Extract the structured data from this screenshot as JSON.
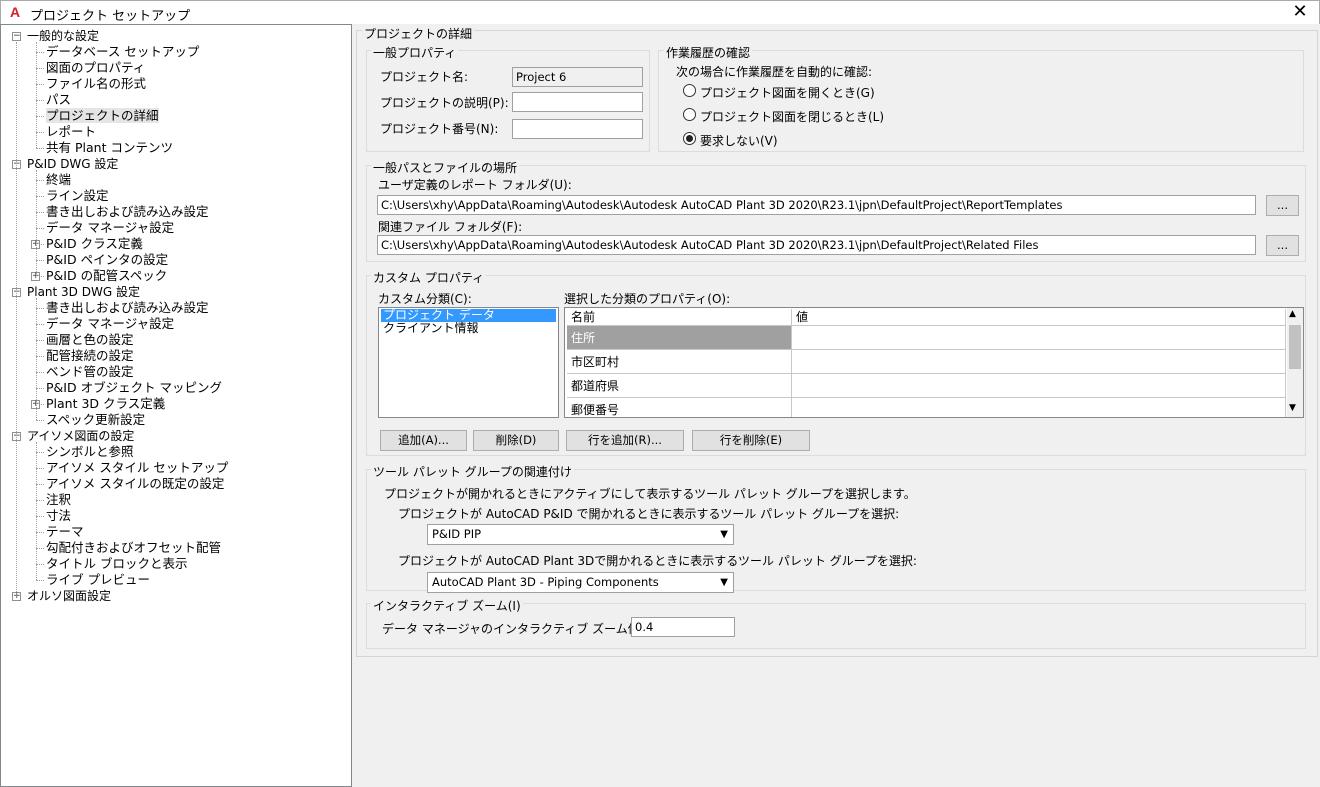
{
  "window": {
    "title": "プロジェクト セットアップ",
    "app_icon": "A"
  },
  "tree": [
    {
      "label": "一般的な設定",
      "level": 0,
      "expander": "−"
    },
    {
      "label": "データベース セットアップ",
      "level": 1
    },
    {
      "label": "図面のプロパティ",
      "level": 1
    },
    {
      "label": "ファイル名の形式",
      "level": 1
    },
    {
      "label": "パス",
      "level": 1
    },
    {
      "label": "プロジェクトの詳細",
      "level": 1,
      "selected": true
    },
    {
      "label": "レポート",
      "level": 1
    },
    {
      "label": "共有 Plant コンテンツ",
      "level": 1
    },
    {
      "label": "P&ID DWG 設定",
      "level": 0,
      "expander": "−"
    },
    {
      "label": "終端",
      "level": 1
    },
    {
      "label": "ライン設定",
      "level": 1
    },
    {
      "label": "書き出しおよび読み込み設定",
      "level": 1
    },
    {
      "label": "データ マネージャ設定",
      "level": 1
    },
    {
      "label": "P&ID クラス定義",
      "level": 1,
      "expander": "+"
    },
    {
      "label": "P&ID ペインタの設定",
      "level": 1
    },
    {
      "label": "P&ID の配管スペック",
      "level": 1,
      "expander": "+"
    },
    {
      "label": "Plant 3D DWG 設定",
      "level": 0,
      "expander": "−"
    },
    {
      "label": "書き出しおよび読み込み設定",
      "level": 1
    },
    {
      "label": "データ マネージャ設定",
      "level": 1
    },
    {
      "label": "画層と色の設定",
      "level": 1
    },
    {
      "label": "配管接続の設定",
      "level": 1
    },
    {
      "label": "ベンド管の設定",
      "level": 1
    },
    {
      "label": "P&ID オブジェクト マッピング",
      "level": 1
    },
    {
      "label": "Plant 3D クラス定義",
      "level": 1,
      "expander": "+"
    },
    {
      "label": "スペック更新設定",
      "level": 1
    },
    {
      "label": "アイソメ図面の設定",
      "level": 0,
      "expander": "−"
    },
    {
      "label": "シンボルと参照",
      "level": 1
    },
    {
      "label": "アイソメ スタイル セットアップ",
      "level": 1
    },
    {
      "label": "アイソメ スタイルの既定の設定",
      "level": 1
    },
    {
      "label": "注釈",
      "level": 1
    },
    {
      "label": "寸法",
      "level": 1
    },
    {
      "label": "テーマ",
      "level": 1
    },
    {
      "label": "勾配付きおよびオフセット配管",
      "level": 1
    },
    {
      "label": "タイトル ブロックと表示",
      "level": 1
    },
    {
      "label": "ライブ プレビュー",
      "level": 1
    },
    {
      "label": "オルソ図面設定",
      "level": 0,
      "expander": "+"
    }
  ],
  "details": {
    "title": "プロジェクトの詳細",
    "general": {
      "title": "一般プロパティ",
      "name_label": "プロジェクト名:",
      "name_value": "Project 6",
      "desc_label": "プロジェクトの説明(P):",
      "desc_value": "",
      "number_label": "プロジェクト番号(N):",
      "number_value": ""
    },
    "history": {
      "title": "作業履歴の確認",
      "prompt": "次の場合に作業履歴を自動的に確認:",
      "options": [
        {
          "label": "プロジェクト図面を開くとき(G)",
          "checked": false
        },
        {
          "label": "プロジェクト図面を閉じるとき(L)",
          "checked": false
        },
        {
          "label": "要求しない(V)",
          "checked": true
        }
      ]
    },
    "paths": {
      "title": "一般パスとファイルの場所",
      "report_label": "ユーザ定義のレポート フォルダ(U):",
      "report_value": "C:\\Users\\xhy\\AppData\\Roaming\\Autodesk\\Autodesk AutoCAD Plant 3D 2020\\R23.1\\jpn\\DefaultProject\\ReportTemplates",
      "related_label": "関連ファイル フォルダ(F):",
      "related_value": "C:\\Users\\xhy\\AppData\\Roaming\\Autodesk\\Autodesk AutoCAD Plant 3D 2020\\R23.1\\jpn\\DefaultProject\\Related Files",
      "browse": "..."
    },
    "custom": {
      "title": "カスタム プロパティ",
      "cat_label": "カスタム分類(C):",
      "categories": [
        "プロジェクト データ",
        "クライアント情報"
      ],
      "props_label": "選択した分類のプロパティ(O):",
      "col_name": "名前",
      "col_value": "値",
      "rows": [
        "住所",
        "市区町村",
        "都道府県",
        "郵便番号"
      ],
      "add": "追加(A)...",
      "delete": "削除(D)",
      "add_row": "行を追加(R)...",
      "delete_row": "行を削除(E)"
    },
    "palette": {
      "title": "ツール パレット グループの関連付け",
      "instruction": "プロジェクトが開かれるときにアクティブにして表示するツール パレット グループを選択します。",
      "pid_label": "プロジェクトが AutoCAD P&ID で開かれるときに表示するツール パレット グループを選択:",
      "pid_value": "P&ID PIP",
      "plant_label": "プロジェクトが AutoCAD Plant 3Dで開かれるときに表示するツール パレット グループを選択:",
      "plant_value": "AutoCAD Plant 3D - Piping Components"
    },
    "zoom": {
      "title": "インタラクティブ ズーム(I)",
      "label": "データ マネージャのインタラクティブ ズーム係数(Z):",
      "value": "0.4"
    }
  }
}
